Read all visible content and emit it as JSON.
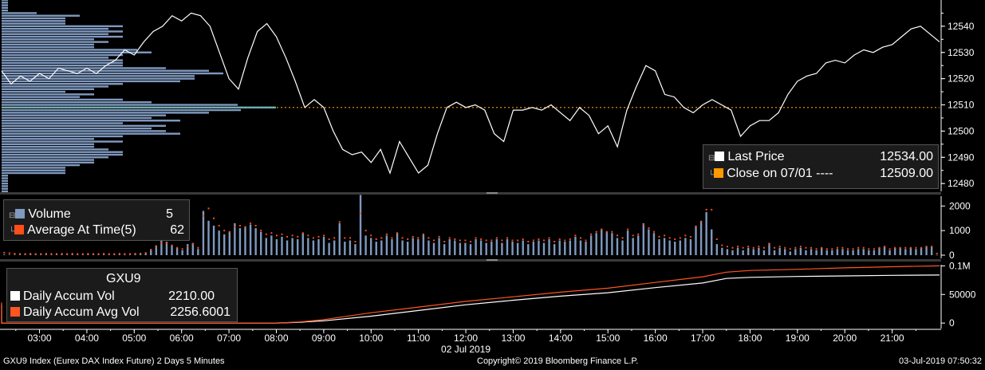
{
  "colors": {
    "background": "#000000",
    "panel_bg": "#1b1b1b",
    "price_line": "#ffffff",
    "prev_close_line": "#ff9900",
    "volume_bars": "#7f99bf",
    "volume_profile": "#7f99bf",
    "volume_profile_highlight": "#4fb3d9",
    "avg_at_time_dots": "#ff4d1a",
    "accum_avg_line": "#ff5522"
  },
  "price_panel": {
    "legend": {
      "last_price_label": "Last Price",
      "last_price_value": "12534.00",
      "close_label": "Close on 07/01 ---- ",
      "close_value": "12509.00"
    }
  },
  "volume_panel": {
    "legend": {
      "volume_label": "Volume",
      "volume_value": "5",
      "avg_label": "Average At Time(5)",
      "avg_value": "62"
    }
  },
  "accum_panel": {
    "legend": {
      "ticker": "GXU9",
      "accum_label": "Daily Accum Vol",
      "accum_value": "2210.00",
      "avg_label": "Daily Accum Avg Vol",
      "avg_value": "2256.6001"
    }
  },
  "date_label": "02 Jul 2019",
  "footer": {
    "left": "GXU9 Index (Eurex DAX Index Future) 2 Days 5 Minutes",
    "center": "Copyright© 2019 Bloomberg Finance L.P.",
    "right": "03-Jul-2019 07:50:32"
  },
  "chart_data": [
    {
      "type": "line",
      "panel": "price",
      "yticks": [
        "12480",
        "12490",
        "12500",
        "12510",
        "12520",
        "12530",
        "12540"
      ],
      "ylim": [
        12477,
        12550
      ],
      "xlim_hours": [
        2.2,
        22.0
      ],
      "x_hours": [
        2.2,
        2.4,
        2.6,
        2.8,
        3.0,
        3.2,
        3.4,
        3.6,
        3.8,
        4.0,
        4.2,
        4.4,
        4.6,
        4.8,
        5.0,
        5.2,
        5.4,
        5.6,
        5.8,
        6.0,
        6.2,
        6.4,
        6.6,
        6.8,
        7.0,
        7.2,
        7.4,
        7.6,
        7.8,
        8.0,
        8.2,
        8.4,
        8.6,
        8.8,
        9.0,
        9.2,
        9.4,
        9.6,
        9.8,
        10.0,
        10.2,
        10.4,
        10.6,
        10.8,
        11.0,
        11.2,
        11.4,
        11.6,
        11.8,
        12.0,
        12.2,
        12.4,
        12.6,
        12.8,
        13.0,
        13.2,
        13.4,
        13.6,
        13.8,
        14.0,
        14.2,
        14.4,
        14.6,
        14.8,
        15.0,
        15.2,
        15.4,
        15.6,
        15.8,
        16.0,
        16.2,
        16.4,
        16.6,
        16.8,
        17.0,
        17.2,
        17.4,
        17.6,
        17.8,
        18.0,
        18.2,
        18.4,
        18.6,
        18.8,
        19.0,
        19.2,
        19.4,
        19.6,
        19.8,
        20.0,
        20.2,
        20.4,
        20.6,
        20.8,
        21.0,
        21.2,
        21.4,
        21.6,
        21.8,
        22.0
      ],
      "series": [
        {
          "name": "Last Price",
          "values": [
            12523,
            12518,
            12521,
            12519,
            12522,
            12520,
            12524,
            12523,
            12522,
            12524,
            12522,
            12525,
            12527,
            12531,
            12529,
            12534,
            12538,
            12540,
            12544,
            12542,
            12545,
            12544,
            12540,
            12530,
            12520,
            12516,
            12528,
            12538,
            12541,
            12536,
            12528,
            12519,
            12509,
            12512,
            12509,
            12500,
            12493,
            12491,
            12492,
            12488,
            12493,
            12484,
            12496,
            12490,
            12484,
            12487,
            12499,
            12509,
            12511,
            12509,
            12510,
            12508,
            12499,
            12496,
            12508,
            12508,
            12509,
            12508,
            12510,
            12507,
            12504,
            12509,
            12506,
            12499,
            12502,
            12494,
            12508,
            12517,
            12525,
            12523,
            12514,
            12513,
            12509,
            12507,
            12510,
            12512,
            12510,
            12508,
            12498,
            12502,
            12504,
            12504,
            12507,
            12514,
            12519,
            12521,
            12522,
            12526,
            12527,
            12526,
            12529,
            12531,
            12530,
            12532,
            12533,
            12536,
            12539,
            12540,
            12537,
            12534
          ]
        },
        {
          "name": "Close on 07/01",
          "values": [
            12509,
            12509
          ]
        }
      ]
    },
    {
      "type": "bar",
      "panel": "volume",
      "yticks": [
        "0",
        "1000",
        "2000"
      ],
      "ylim": [
        0,
        2400
      ],
      "series": [
        {
          "name": "Volume",
          "values": [
            30,
            20,
            20,
            20,
            20,
            30,
            20,
            20,
            30,
            20,
            20,
            30,
            20,
            30,
            20,
            20,
            30,
            20,
            20,
            30,
            20,
            20,
            30,
            20,
            20,
            40,
            50,
            80,
            250,
            400,
            700,
            550,
            400,
            300,
            200,
            450,
            500,
            250,
            1800,
            1400,
            1200,
            1000,
            850,
            950,
            1300,
            1100,
            1150,
            1250,
            1100,
            950,
            700,
            800,
            650,
            750,
            600,
            700,
            650,
            900,
            700,
            600,
            650,
            750,
            500,
            600,
            1300,
            550,
            600,
            450,
            2450,
            800,
            700,
            550,
            600,
            800,
            650,
            900,
            600,
            550,
            700,
            650,
            850,
            600,
            500,
            700,
            450,
            650,
            600,
            500,
            500,
            450,
            650,
            600,
            500,
            550,
            650,
            500,
            650,
            550,
            500,
            600,
            450,
            550,
            600,
            500,
            650,
            450,
            600,
            550,
            600,
            750,
            600,
            550,
            800,
            900,
            1050,
            950,
            900,
            700,
            600,
            1000,
            700,
            800,
            1300,
            1050,
            900,
            650,
            700,
            600,
            550,
            600,
            700,
            650,
            1200,
            1400,
            1750,
            1050,
            450,
            300,
            250,
            200,
            300,
            200,
            300,
            250,
            300,
            200,
            500,
            200,
            300,
            250,
            150,
            250,
            300,
            200,
            250,
            200,
            300,
            200,
            200,
            250,
            250,
            200,
            200,
            250,
            250,
            200,
            200,
            300,
            350,
            200,
            300,
            300,
            250,
            300,
            250,
            300,
            350,
            350,
            5
          ]
        },
        {
          "name": "Average At Time(5)",
          "values": [
            100,
            80,
            60,
            50,
            50,
            60,
            50,
            50,
            60,
            50,
            50,
            60,
            50,
            60,
            50,
            50,
            60,
            50,
            50,
            60,
            50,
            50,
            60,
            50,
            50,
            60,
            70,
            90,
            200,
            350,
            500,
            500,
            400,
            300,
            250,
            350,
            450,
            300,
            1600,
            1900,
            1500,
            1200,
            1000,
            950,
            1150,
            1200,
            1150,
            1300,
            1200,
            1000,
            850,
            900,
            800,
            850,
            750,
            800,
            750,
            900,
            800,
            700,
            750,
            800,
            650,
            700,
            1350,
            700,
            700,
            550,
            1700,
            1000,
            800,
            650,
            700,
            850,
            700,
            900,
            700,
            650,
            750,
            700,
            850,
            700,
            600,
            750,
            550,
            700,
            650,
            600,
            600,
            550,
            700,
            650,
            600,
            600,
            700,
            600,
            700,
            600,
            600,
            650,
            550,
            600,
            650,
            600,
            700,
            550,
            650,
            600,
            650,
            800,
            700,
            600,
            850,
            950,
            1050,
            950,
            950,
            800,
            700,
            1050,
            800,
            850,
            1250,
            1100,
            950,
            750,
            800,
            700,
            650,
            700,
            800,
            750,
            1150,
            1350,
            1850,
            1850,
            650,
            400,
            350,
            300,
            350,
            300,
            350,
            300,
            350,
            300,
            450,
            300,
            350,
            300,
            250,
            300,
            350,
            300,
            300,
            250,
            300,
            250,
            250,
            300,
            300,
            250,
            250,
            300,
            300,
            250,
            250,
            300,
            350,
            250,
            300,
            300,
            300,
            300,
            300,
            300,
            350,
            350,
            62
          ]
        }
      ]
    },
    {
      "type": "line",
      "panel": "accumulated volume",
      "yticks": [
        "0",
        "50000",
        "0.1M"
      ],
      "ylim": [
        -4000,
        102000
      ],
      "x_hours": [
        2.2,
        2.5,
        3.0,
        4.0,
        5.0,
        6.0,
        7.0,
        8.0,
        8.5,
        9.0,
        10.0,
        11.0,
        12.0,
        13.0,
        14.0,
        15.0,
        16.0,
        17.0,
        17.5,
        18.0,
        19.0,
        20.0,
        21.0,
        22.0
      ],
      "series": [
        {
          "name": "Daily Accum Vol",
          "values": [
            0,
            0,
            0,
            0,
            0,
            0,
            0,
            0,
            1500,
            4000,
            12000,
            22000,
            32000,
            40000,
            47000,
            53000,
            62000,
            70000,
            78000,
            80000,
            81500,
            82500,
            83500,
            84000
          ]
        },
        {
          "name": "Daily Accum Avg Vol",
          "values": [
            0,
            0,
            0,
            0,
            0,
            0,
            0,
            0,
            2000,
            6000,
            18000,
            28000,
            38000,
            46000,
            54000,
            61000,
            71000,
            81000,
            89000,
            92000,
            94000,
            96500,
            98500,
            100000
          ]
        }
      ]
    }
  ],
  "time_axis": [
    "03:00",
    "04:00",
    "05:00",
    "06:00",
    "07:00",
    "08:00",
    "09:00",
    "10:00",
    "11:00",
    "12:00",
    "13:00",
    "14:00",
    "15:00",
    "16:00",
    "17:00",
    "18:00",
    "19:00",
    "20:00",
    "21:00"
  ]
}
